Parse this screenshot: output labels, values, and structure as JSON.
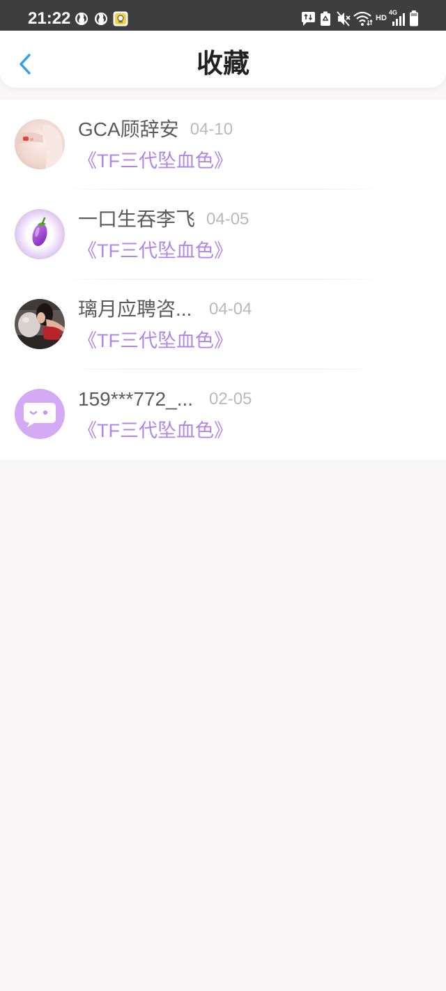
{
  "status_bar": {
    "time": "21:22",
    "hd_label": "HD",
    "network_label": "4G",
    "left_icons": [
      "globe-icon",
      "globe-icon",
      "app-notification-icon"
    ],
    "right_icons": [
      "message-sync-icon",
      "recycle-icon",
      "mute-icon",
      "wifi-icon",
      "signal-icon",
      "battery-icon"
    ]
  },
  "header": {
    "back_icon": "chevron-left-icon",
    "title": "收藏"
  },
  "favorites": [
    {
      "name": "GCA顾辞安",
      "date": "04-10",
      "work": "《TF三代坠血色》"
    },
    {
      "name": "一口生吞李飞",
      "date": "04-05",
      "work": "《TF三代坠血色》",
      "avatar_icon": "eggplant-icon"
    },
    {
      "name": "璃月应聘咨...",
      "date": "04-04",
      "work": "《TF三代坠血色》"
    },
    {
      "name": "159***772_...",
      "date": "02-05",
      "work": "《TF三代坠血色》",
      "avatar_icon": "chat-face-icon"
    }
  ],
  "colors": {
    "status_bar_bg": "#3e3e3e",
    "accent_blue": "#2e9ef2",
    "title_text": "#222222",
    "name_text": "#5a5a5a",
    "date_text": "#b9b9b9",
    "work_title_purple": "#b286e6",
    "page_bg": "#f8f6f7",
    "default_avatar_bg": "#d3aaf3"
  }
}
